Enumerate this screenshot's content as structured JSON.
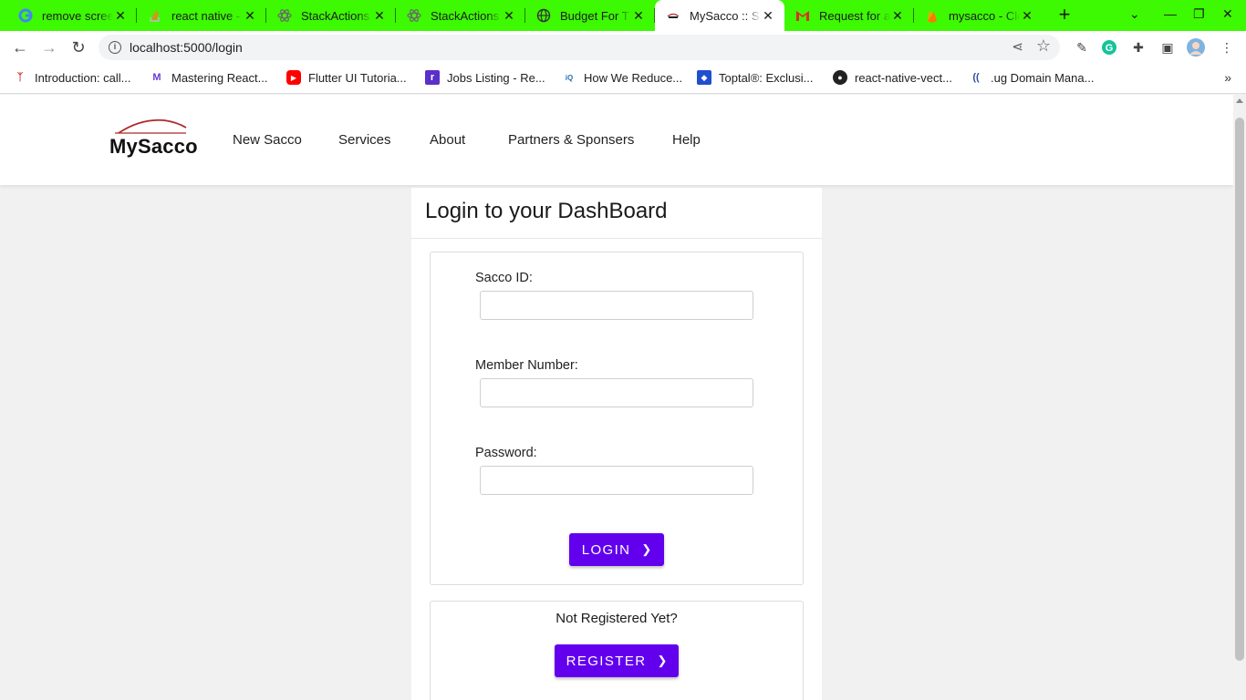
{
  "browser": {
    "tabs": [
      {
        "title": "remove scree",
        "icon": "google-icon",
        "active": false
      },
      {
        "title": "react native -",
        "icon": "stackoverflow-icon",
        "active": false
      },
      {
        "title": "StackActions",
        "icon": "react-icon",
        "active": false
      },
      {
        "title": "StackActions",
        "icon": "react-icon",
        "active": false
      },
      {
        "title": "Budget For T",
        "icon": "globe-icon",
        "active": false
      },
      {
        "title": "MySacco :: Sa",
        "icon": "mysacco-icon",
        "active": true
      },
      {
        "title": "Request for a",
        "icon": "gmail-icon",
        "active": false
      },
      {
        "title": "mysacco - Clo",
        "icon": "firebase-icon",
        "active": false
      }
    ],
    "url": "localhost:5000/login",
    "bookmarks": [
      {
        "label": "Introduction: call...",
        "icon": "bookmark-antenna-icon"
      },
      {
        "label": "Mastering React...",
        "icon": "bookmark-m-icon"
      },
      {
        "label": "Flutter UI Tutoria...",
        "icon": "youtube-icon"
      },
      {
        "label": "Jobs Listing - Re...",
        "icon": "bookmark-r-icon"
      },
      {
        "label": "How We Reduce...",
        "icon": "infoq-icon"
      },
      {
        "label": "Toptal®: Exclusi...",
        "icon": "toptal-icon"
      },
      {
        "label": "react-native-vect...",
        "icon": "github-icon"
      },
      {
        "label": ".ug Domain Mana...",
        "icon": "ug-domain-icon"
      }
    ],
    "accent_color": "#3df902"
  },
  "site": {
    "logo_text": "MySacco",
    "nav": [
      {
        "label": "New Sacco"
      },
      {
        "label": "Services"
      },
      {
        "label": "About"
      },
      {
        "label": "Partners & Sponsers"
      },
      {
        "label": "Help"
      }
    ]
  },
  "login": {
    "title": "Login to your DashBoard",
    "fields": [
      {
        "label": "Sacco ID:",
        "value": ""
      },
      {
        "label": "Member Number:",
        "value": ""
      },
      {
        "label": "Password:",
        "value": ""
      }
    ],
    "login_button": "LOGIN",
    "not_registered": "Not Registered Yet?",
    "register_button": "REGISTER",
    "button_color": "#6200ee"
  }
}
